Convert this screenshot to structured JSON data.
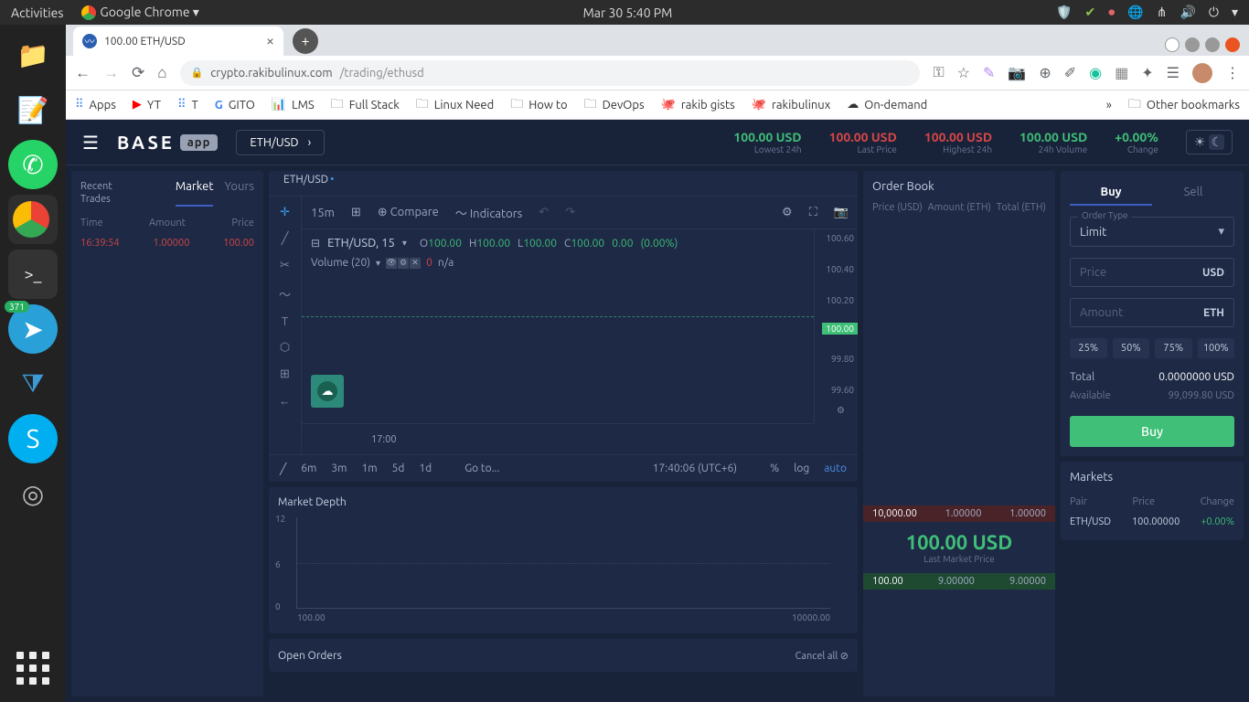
{
  "gnome": {
    "activities": "Activities",
    "app": "Google Chrome ▾",
    "clock": "Mar 30   5:40 PM"
  },
  "dock": {
    "telegram_badge": "371"
  },
  "browser": {
    "tab_title": "100.00 ETH/USD",
    "url_host": "crypto.rakibulinux.com",
    "url_path": "/trading/ethusd"
  },
  "bookmarks": {
    "apps": "Apps",
    "yt": "YT",
    "t": "T",
    "gito": "GITO",
    "lms": "LMS",
    "fullstack": "Full Stack",
    "linux": "Linux Need",
    "howto": "How to",
    "devops": "DevOps",
    "rakibgists": "rakib gists",
    "rakibulinux": "rakibulinux",
    "ondemand": "On-demand",
    "other": "Other bookmarks"
  },
  "header": {
    "logo": "BASE",
    "logo_badge": "app",
    "pair": "ETH/USD",
    "stats": {
      "lowest": {
        "value": "100.00 USD",
        "label": "Lowest 24h"
      },
      "last": {
        "value": "100.00 USD",
        "label": "Last Price"
      },
      "highest": {
        "value": "100.00 USD",
        "label": "Highest 24h"
      },
      "volume": {
        "value": "100.00 USD",
        "label": "24h Volume"
      },
      "change": {
        "value": "+0.00%",
        "label": "Change"
      }
    }
  },
  "trades": {
    "recent_label": "Recent Trades",
    "tab_market": "Market",
    "tab_yours": "Yours",
    "col_time": "Time",
    "col_amount": "Amount",
    "col_price": "Price",
    "rows": [
      {
        "time": "16:39:54",
        "amount": "1.00000",
        "price": "100.00"
      }
    ]
  },
  "chart": {
    "pair_label": "ETH/USD",
    "interval": "15m",
    "compare": "Compare",
    "indicators": "Indicators",
    "symbol_line": "ETH/USD, 15",
    "ohlc": {
      "o_lbl": "O",
      "o": "100.00",
      "h_lbl": "H",
      "h": "100.00",
      "l_lbl": "L",
      "l": "100.00",
      "c_lbl": "C",
      "c": "100.00",
      "chg1": "0.00",
      "chg2": "(0.00%)"
    },
    "volume_label": "Volume (20)",
    "volume_val": "0",
    "volume_na": "n/a",
    "y_ticks": [
      "100.60",
      "100.40",
      "100.20",
      "100.00",
      "99.80",
      "99.60"
    ],
    "y_mark": "100.00",
    "x_tick": "17:00",
    "ranges": [
      "6m",
      "3m",
      "1m",
      "5d",
      "1d"
    ],
    "goto": "Go to...",
    "time_utc": "17:40:06 (UTC+6)",
    "pct": "%",
    "log": "log",
    "auto": "auto"
  },
  "depth": {
    "title": "Market Depth",
    "y_ticks": [
      "12",
      "6",
      "0"
    ],
    "x_ticks": [
      "100.00",
      "10000.00"
    ]
  },
  "open_orders": {
    "title": "Open Orders",
    "cancel": "Cancel all"
  },
  "orderbook": {
    "title": "Order Book",
    "col_price": "Price (USD)",
    "col_amount": "Amount (ETH)",
    "col_total": "Total (ETH)",
    "asks": [
      {
        "price": "10,000.00",
        "amount": "1.00000",
        "total": "1.00000"
      }
    ],
    "mid_price": "100.00 USD",
    "mid_label": "Last Market Price",
    "bids": [
      {
        "price": "100.00",
        "amount": "9.00000",
        "total": "9.00000"
      }
    ]
  },
  "form": {
    "tab_buy": "Buy",
    "tab_sell": "Sell",
    "order_type_label": "Order Type",
    "order_type_value": "Limit",
    "price_ph": "Price",
    "price_unit": "USD",
    "amount_ph": "Amount",
    "amount_unit": "ETH",
    "pcts": [
      "25%",
      "50%",
      "75%",
      "100%"
    ],
    "total_label": "Total",
    "total_value": "0.0000000  USD",
    "avail_label": "Available",
    "avail_value": "99,099.80  USD",
    "submit": "Buy"
  },
  "markets": {
    "title": "Markets",
    "col_pair": "Pair",
    "col_price": "Price",
    "col_change": "Change",
    "rows": [
      {
        "pair": "ETH/USD",
        "price": "100.00000",
        "change": "+0.00%"
      }
    ]
  },
  "chart_data": {
    "type": "line",
    "title": "ETH/USD 15m",
    "x": [
      "17:00"
    ],
    "series": [
      {
        "name": "Close",
        "values": [
          100.0
        ]
      }
    ],
    "ylim": [
      99.6,
      100.6
    ]
  }
}
